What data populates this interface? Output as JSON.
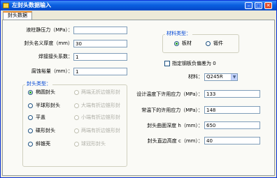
{
  "window": {
    "title": "左封头数据输入",
    "minimize_glyph": "–",
    "maximize_glyph": "□",
    "close_glyph": "✕"
  },
  "tabs": [
    {
      "label": "封头数据",
      "active": true
    }
  ],
  "left": {
    "fields": [
      {
        "label": "液柱静压力（MPa）：",
        "value": ""
      },
      {
        "label": "封头名义厚度（mm）",
        "value": "30"
      },
      {
        "label": "焊接接头系数：",
        "value": "1"
      },
      {
        "label": "腐蚀裕量（mm）：",
        "value": "1"
      }
    ],
    "head_type_group": {
      "title": "封头类型：",
      "options_left": [
        {
          "label": "椭圆封头",
          "selected": true,
          "enabled": true
        },
        {
          "label": "半球形封头",
          "selected": false,
          "enabled": true
        },
        {
          "label": "平盖",
          "selected": false,
          "enabled": true
        },
        {
          "label": "碟形封头",
          "selected": false,
          "enabled": true
        },
        {
          "label": "斜锥壳",
          "selected": false,
          "enabled": true
        }
      ],
      "options_right": [
        {
          "label": "两端无折边锥形封",
          "selected": false,
          "enabled": false
        },
        {
          "label": "大端有折边锥形封",
          "selected": false,
          "enabled": false
        },
        {
          "label": "小端有折边锥形封",
          "selected": false,
          "enabled": false
        },
        {
          "label": "两端有折边锥形封",
          "selected": false,
          "enabled": false
        },
        {
          "label": "球冠形封头",
          "selected": false,
          "enabled": false
        }
      ]
    }
  },
  "right": {
    "material_type_group": {
      "title": "材料类型：",
      "options": [
        {
          "label": "板材",
          "selected": true
        },
        {
          "label": "锻件",
          "selected": false
        }
      ]
    },
    "checkbox": {
      "label": "指定钢板负偏差为 0",
      "checked": false
    },
    "material": {
      "label": "材料：",
      "value": "Q245R"
    },
    "fields": [
      {
        "label": "设计温度下许用应力（MPa）：",
        "value": "133"
      },
      {
        "label": "常温下的许用应力（MPa）：",
        "value": "148"
      },
      {
        "label": "封头曲面深度 h（mm）：",
        "value": "650"
      },
      {
        "label": "封头直边高度 c（mm）：",
        "value": "40"
      }
    ]
  }
}
